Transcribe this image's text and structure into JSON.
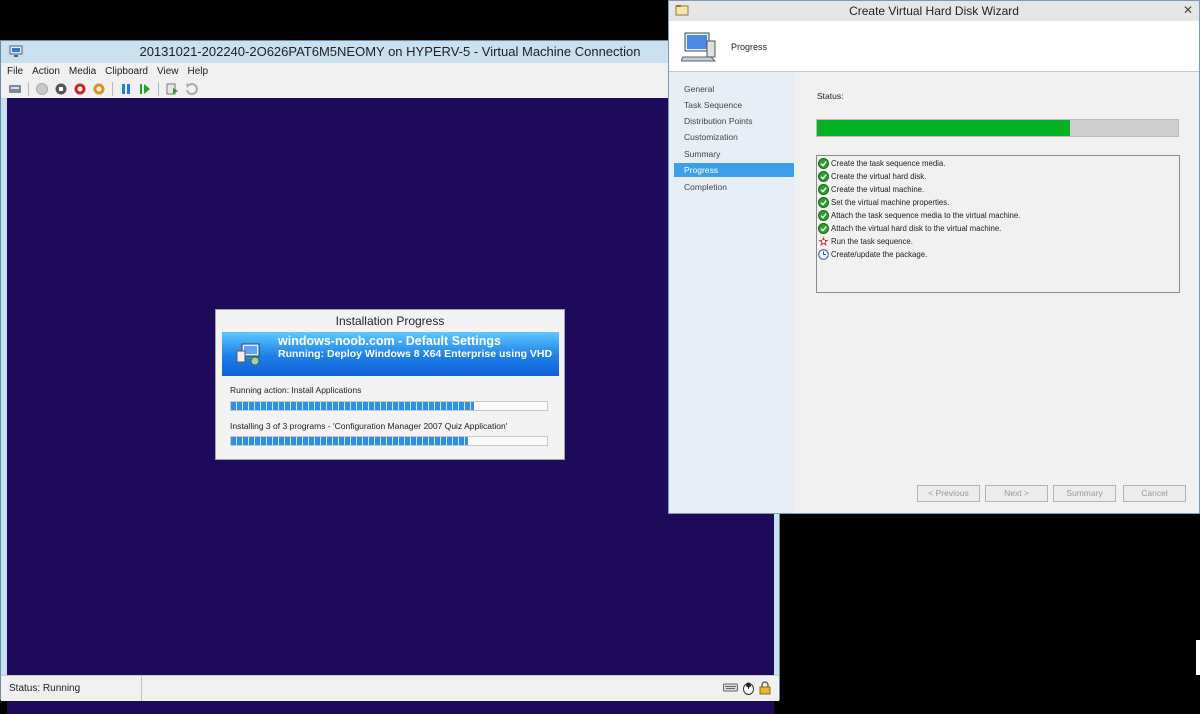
{
  "vm": {
    "title": "20131021-202240-2O626PAT6M5NEOMY on HYPERV-5 - Virtual Machine Connection",
    "menu": [
      "File",
      "Action",
      "Media",
      "Clipboard",
      "View",
      "Help"
    ],
    "status": "Status: Running"
  },
  "install_progress": {
    "title": "Installation Progress",
    "banner_line1": "windows-noob.com - Default Settings",
    "banner_line2": "Running: Deploy Windows 8 X64 Enterprise using VHD",
    "action_text": "Running action: Install Applications",
    "action_progress": 0.77,
    "item_text": "Installing 3 of 3 programs - 'Configuration Manager 2007 Quiz Application'",
    "item_progress": 0.75
  },
  "wizard": {
    "title": "Create Virtual Hard Disk Wizard",
    "header": "Progress",
    "nav": [
      "General",
      "Task Sequence",
      "Distribution Points",
      "Customization",
      "Summary",
      "Progress",
      "Completion"
    ],
    "active_nav_index": 5,
    "status_label": "Status:",
    "progress": 0.7,
    "log": [
      {
        "text": "Create the task sequence media.",
        "state": "done"
      },
      {
        "text": "Create the virtual hard disk.",
        "state": "done"
      },
      {
        "text": "Create the virtual machine.",
        "state": "done"
      },
      {
        "text": "Set the virtual machine properties.",
        "state": "done"
      },
      {
        "text": "Attach the task sequence media to the virtual machine.",
        "state": "done"
      },
      {
        "text": "Attach the virtual hard disk to the virtual machine.",
        "state": "done"
      },
      {
        "text": "Run the task sequence.",
        "state": "running"
      },
      {
        "text": "Create/update the package.",
        "state": "pending"
      }
    ],
    "buttons": {
      "previous": "< Previous",
      "next": "Next >",
      "summary": "Summary",
      "cancel": "Cancel"
    }
  },
  "colors": {
    "vm_screen": "#1d0a5a",
    "progress_green": "#06b025",
    "nav_active": "#3ca0ea"
  }
}
